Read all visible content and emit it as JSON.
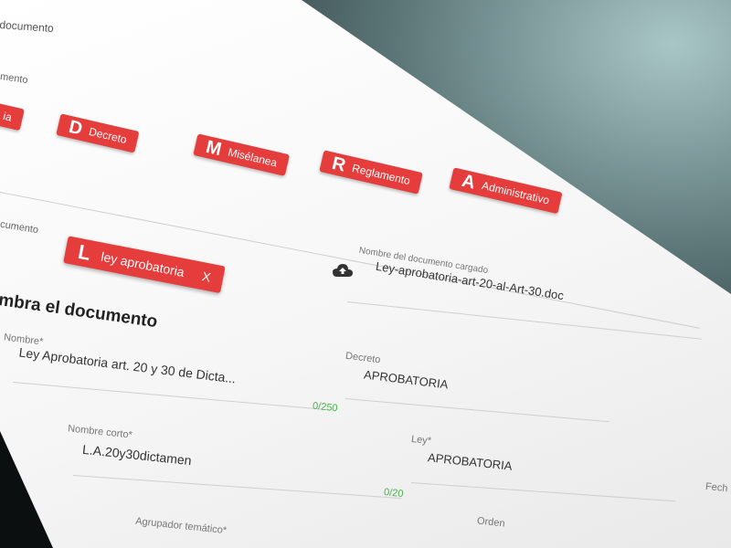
{
  "topbar": {
    "title": "documento"
  },
  "type_section": {
    "label": "mento"
  },
  "document_types": [
    {
      "letter": "",
      "label": "ia"
    },
    {
      "letter": "D",
      "label": "Decreto"
    },
    {
      "letter": "M",
      "label": "Misélanea"
    },
    {
      "letter": "R",
      "label": "Reglamento"
    },
    {
      "letter": "A",
      "label": "Administrativo"
    }
  ],
  "selected_section": {
    "label": "cumento"
  },
  "selected_type": {
    "letter": "L",
    "label": "ley aprobatoria",
    "remove": "X"
  },
  "upload": {
    "label": "Nombre del documento cargado",
    "filename": "Ley-aprobatoria-art-20-al-Art-30.doc"
  },
  "form": {
    "heading": "mbra el documento",
    "nombre": {
      "label": "Nombre*",
      "value": "Ley Aprobatoria art. 20 y 30 de Dicta..."
    },
    "decreto": {
      "label": "Decreto",
      "value": "APROBATORIA"
    },
    "nombre_counter": "0/250",
    "nombre_corto": {
      "label": "Nombre corto*",
      "value": "L.A.20y30dictamen"
    },
    "ley": {
      "label": "Ley*",
      "value": "APROBATORIA"
    },
    "corto_counter": "0/20",
    "fecha_label": "Fech",
    "agrupador": {
      "label": "Agrupador temático*"
    },
    "orden": {
      "label": "Orden"
    }
  },
  "colors": {
    "accent": "#e53c3c",
    "counter": "#4caf50"
  }
}
